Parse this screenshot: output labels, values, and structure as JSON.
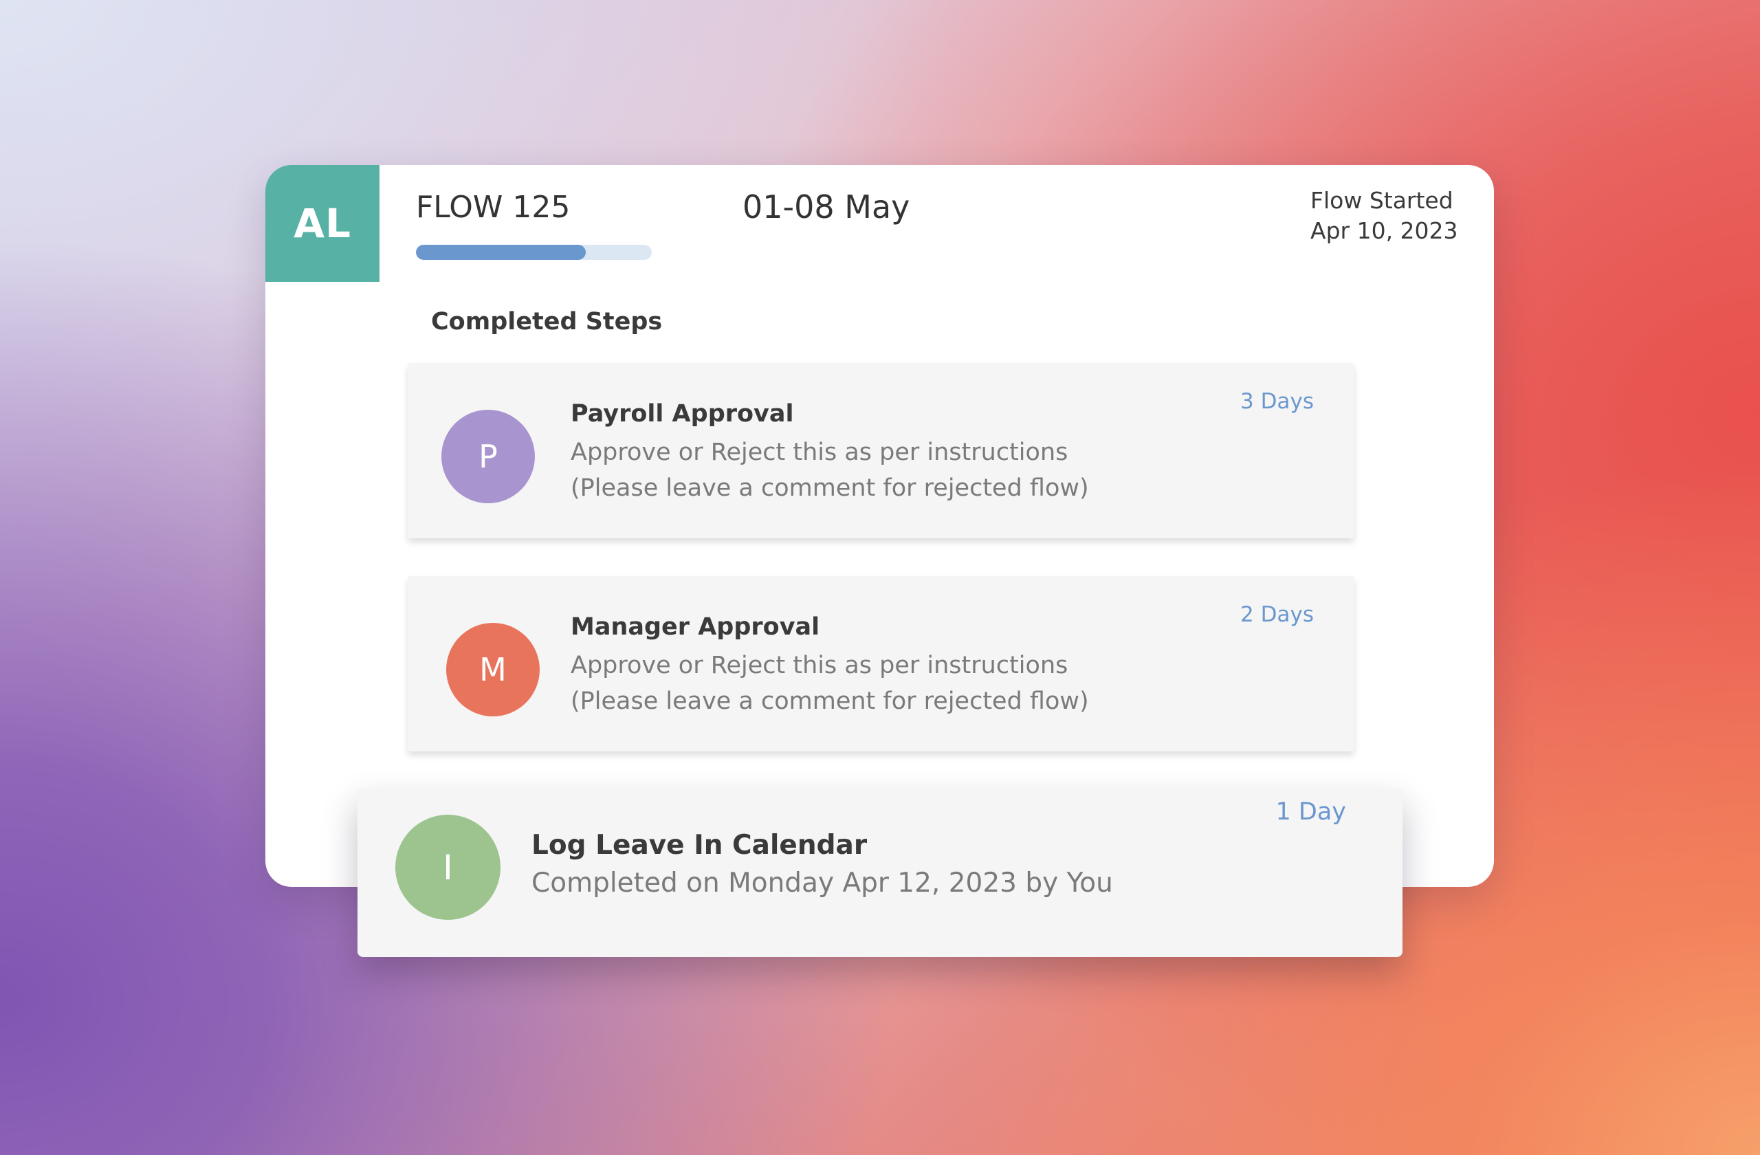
{
  "flow": {
    "initials": "AL",
    "name": "FLOW 125",
    "date_range": "01-08 May",
    "started_label": "Flow Started",
    "started_date": "Apr 10, 2023",
    "progress_percent": 72
  },
  "section": {
    "title": "Completed Steps"
  },
  "steps": [
    {
      "avatar_letter": "P",
      "avatar_color": "#a894cf",
      "title": "Payroll Approval",
      "description_line1": "Approve or Reject this as per instructions",
      "description_line2": "(Please leave a comment for rejected flow)",
      "duration": "3 Days"
    },
    {
      "avatar_letter": "M",
      "avatar_color": "#e8745c",
      "title": "Manager Approval",
      "description_line1": "Approve or Reject this as per instructions",
      "description_line2": "(Please leave a comment for rejected flow)",
      "duration": "2 Days"
    }
  ],
  "current_step": {
    "avatar_letter": "I",
    "avatar_color": "#9dc48e",
    "title": "Log Leave In Calendar",
    "description": "Completed on Monday Apr 12, 2023 by You",
    "duration": "1 Day"
  },
  "colors": {
    "initials_tile": "#57b1a5",
    "progress_fill": "#6b97cf",
    "progress_track": "#dbe7f3",
    "duration_text": "#6b97cf"
  }
}
